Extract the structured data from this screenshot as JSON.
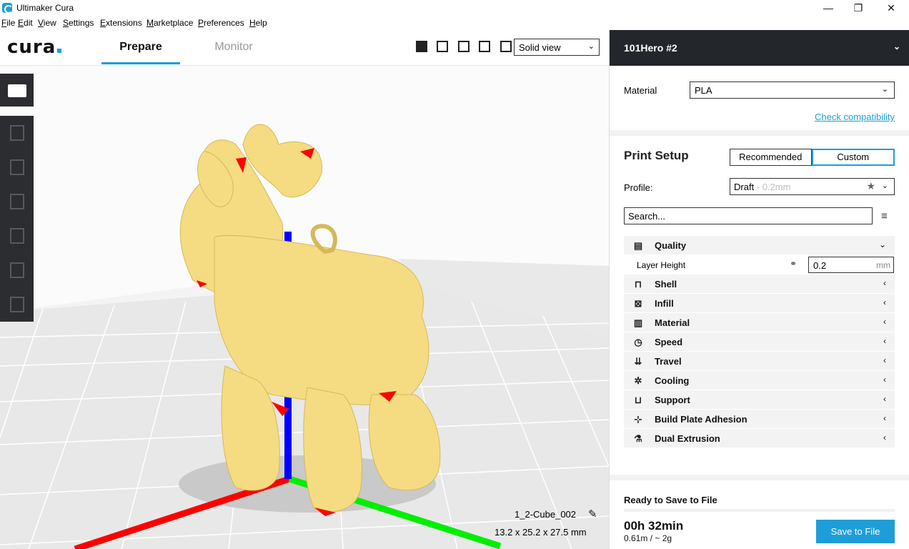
{
  "window": {
    "title": "Ultimaker Cura",
    "minimize": "—",
    "maximize": "❐",
    "close": "✕"
  },
  "menu": [
    "File",
    "Edit",
    "View",
    "Settings",
    "Extensions",
    "Marketplace",
    "Preferences",
    "Help"
  ],
  "toolbar": {
    "logo": "cura",
    "tabs": [
      {
        "label": "Prepare",
        "active": true
      },
      {
        "label": "Monitor",
        "active": false
      }
    ],
    "view_icons": [
      "3d-view-icon",
      "front-view-icon",
      "top-view-icon",
      "left-view-icon",
      "right-view-icon"
    ],
    "view_mode": "Solid view"
  },
  "viewport": {
    "left_tools": [
      "open-file-icon",
      "move-tool-icon",
      "scale-tool-icon",
      "rotate-tool-icon",
      "mirror-tool-icon",
      "per-model-settings-icon",
      "support-blocker-icon"
    ],
    "model_name": "1_2-Cube_002",
    "model_dimensions": "13.2 x 25.2 x 27.5 mm",
    "colors": {
      "model": "#f5dc82",
      "overhang": "#ff0000",
      "x_axis": "#ff0000",
      "y_axis": "#00ff00",
      "z_axis": "#0000ff",
      "background": "#f3f3f3"
    }
  },
  "panel": {
    "printer": "101Hero #2",
    "material_label": "Material",
    "material_value": "PLA",
    "compat_link": "Check compatibility",
    "print_setup_title": "Print Setup",
    "modes": [
      {
        "label": "Recommended",
        "active": false
      },
      {
        "label": "Custom",
        "active": true
      }
    ],
    "profile_label": "Profile:",
    "profile_value": "Draft",
    "profile_sub": " - 0.2mm",
    "search_placeholder": "Search...",
    "quality": {
      "name": "Quality",
      "icon": "quality-icon",
      "expanded": true
    },
    "layer_height": {
      "label": "Layer Height",
      "value": "0.2",
      "unit": "mm"
    },
    "categories": [
      {
        "name": "Shell",
        "icon": "shell-icon",
        "glyph": "⊓"
      },
      {
        "name": "Infill",
        "icon": "infill-icon",
        "glyph": "⊠"
      },
      {
        "name": "Material",
        "icon": "material-icon",
        "glyph": "▥"
      },
      {
        "name": "Speed",
        "icon": "speed-icon",
        "glyph": "◷"
      },
      {
        "name": "Travel",
        "icon": "travel-icon",
        "glyph": "⇊"
      },
      {
        "name": "Cooling",
        "icon": "cooling-icon",
        "glyph": "✲"
      },
      {
        "name": "Support",
        "icon": "support-icon",
        "glyph": "⊔"
      },
      {
        "name": "Build Plate Adhesion",
        "icon": "adhesion-icon",
        "glyph": "⊹"
      },
      {
        "name": "Dual Extrusion",
        "icon": "dual-extrusion-icon",
        "glyph": "⚗"
      }
    ],
    "bottom": {
      "status": "Ready to Save to File",
      "time": "00h 32min",
      "usage": "0.61m / ~ 2g",
      "save_label": "Save to File",
      "accent": "#1e9ed8"
    }
  }
}
